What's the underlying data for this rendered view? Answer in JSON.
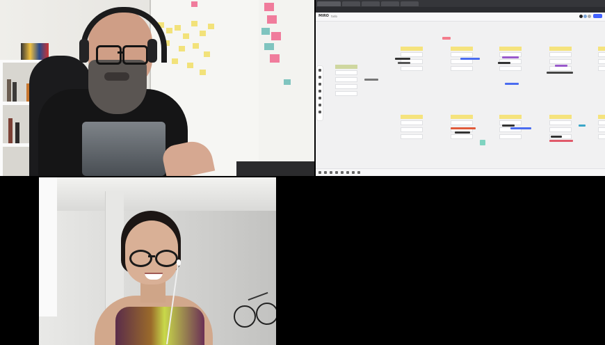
{
  "meeting": {
    "participants": [
      {
        "tile": "top-left",
        "kind": "camera"
      },
      {
        "tile": "bottom-left",
        "kind": "camera"
      }
    ]
  },
  "screen_share": {
    "app_title": "MIRO",
    "app_subtitle": "todo",
    "share_button_color": "#4262ff",
    "sticky_color": "#f5e37d",
    "frame_count": 10
  },
  "icons": [
    "headphones-icon",
    "earbud-icon",
    "share-button-icon",
    "toolbar-icon",
    "zoom-icon"
  ]
}
